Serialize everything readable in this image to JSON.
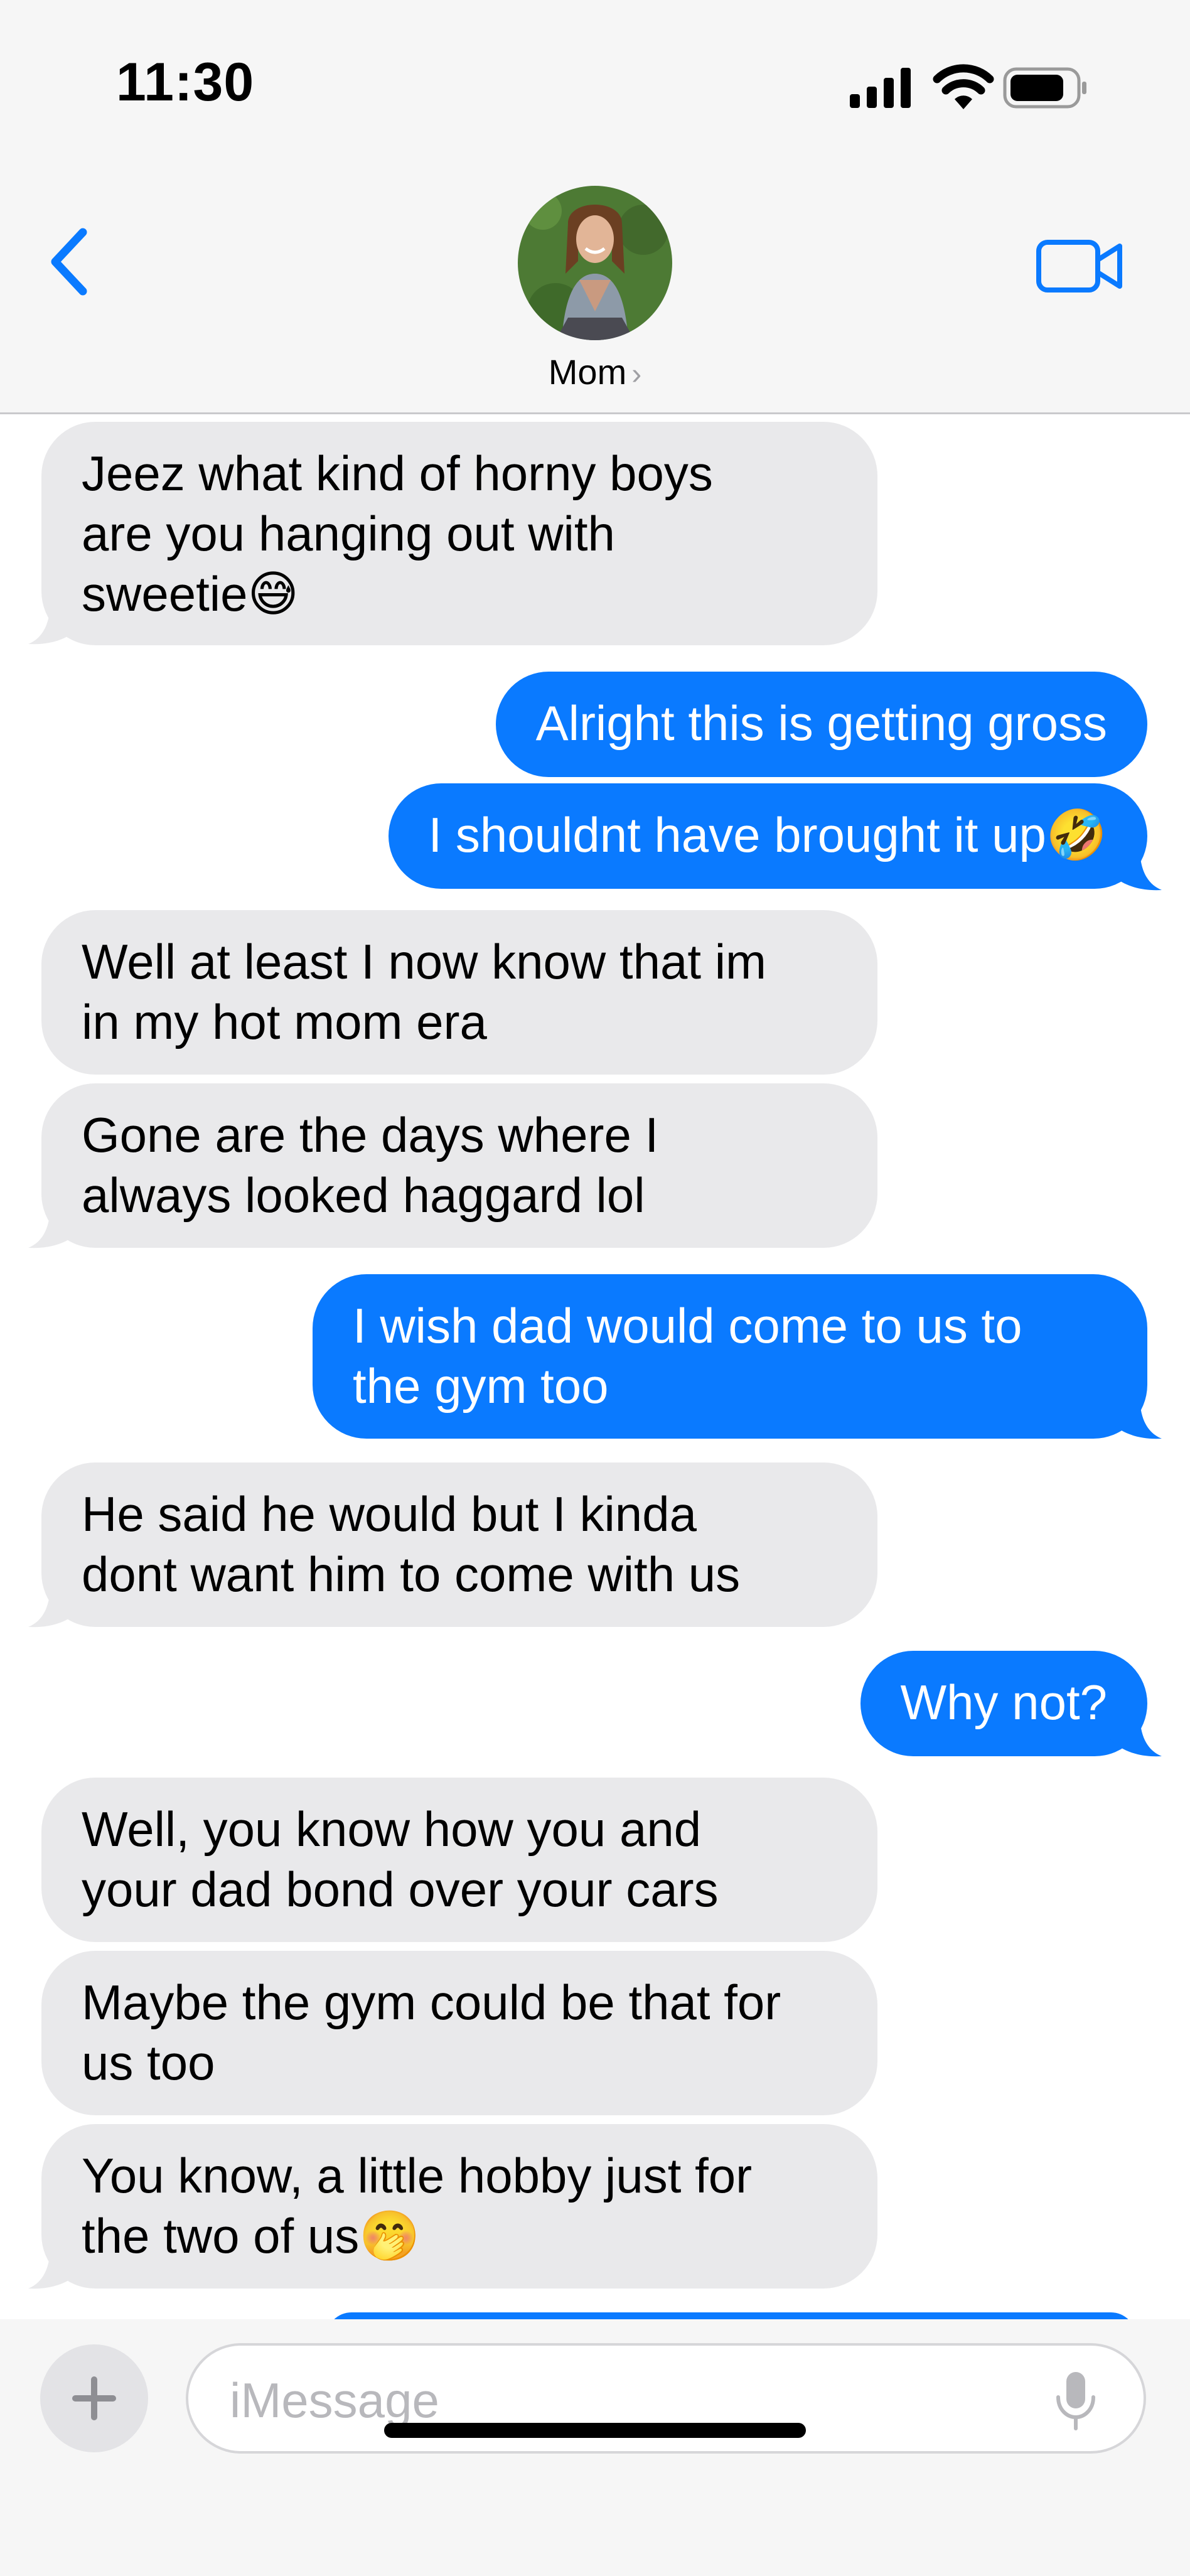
{
  "status_bar": {
    "time": "11:30"
  },
  "header": {
    "contact_name": "Mom",
    "name_chevron": "›"
  },
  "messages": [
    {
      "from": "contact",
      "text": "Jeez what kind of horny boys\nare you hanging out with\nsweetie😅"
    },
    {
      "from": "me",
      "text": "Alright this is getting gross"
    },
    {
      "from": "me",
      "text": "I shouldnt have brought it up🤣"
    },
    {
      "from": "contact",
      "text": "Well at least I now know that im\nin my hot mom era"
    },
    {
      "from": "contact",
      "text": "Gone are the days where I\nalways looked haggard lol"
    },
    {
      "from": "me",
      "text": "I wish dad would come to us to\nthe gym too"
    },
    {
      "from": "contact",
      "text": "He said he would but I kinda\ndont want him to come with us"
    },
    {
      "from": "me",
      "text": "Why not?"
    },
    {
      "from": "contact",
      "text": "Well, you know how you and\nyour dad bond over your cars"
    },
    {
      "from": "contact",
      "text": "Maybe the gym could be that for\nus too"
    },
    {
      "from": "contact",
      "text": "You know, a little hobby just for\nthe two of us🤭"
    }
  ],
  "input_bar": {
    "placeholder": "iMessage"
  },
  "colors": {
    "outgoing_bubble": "#0a7aff",
    "incoming_bubble": "#e9e9eb",
    "accent": "#0a7aff"
  },
  "icons": [
    "back-chevron-icon",
    "video-call-icon",
    "plus-icon",
    "microphone-icon",
    "signal-icon",
    "wifi-icon",
    "battery-icon"
  ]
}
